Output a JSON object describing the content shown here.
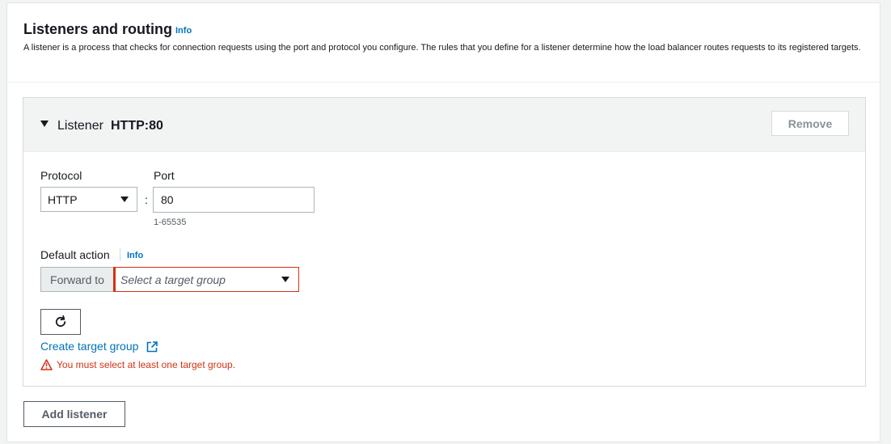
{
  "section": {
    "title": "Listeners and routing",
    "info": "Info",
    "description": "A listener is a process that checks for connection requests using the port and protocol you configure. The rules that you define for a listener determine how the load balancer routes requests to its registered targets."
  },
  "listener": {
    "label": "Listener",
    "value": "HTTP:80",
    "remove_label": "Remove",
    "protocol_label": "Protocol",
    "protocol_value": "HTTP",
    "colon": ":",
    "port_label": "Port",
    "port_value": "80",
    "port_hint": "1-65535",
    "default_action_label": "Default action",
    "default_action_info": "Info",
    "forward_to_label": "Forward to",
    "target_group_placeholder": "Select a target group",
    "create_target_group_link": "Create target group",
    "error_message": "You must select at least one target group."
  },
  "footer": {
    "add_listener_label": "Add listener"
  },
  "colors": {
    "link": "#0073bb",
    "error": "#d13212",
    "text": "#16191f"
  }
}
